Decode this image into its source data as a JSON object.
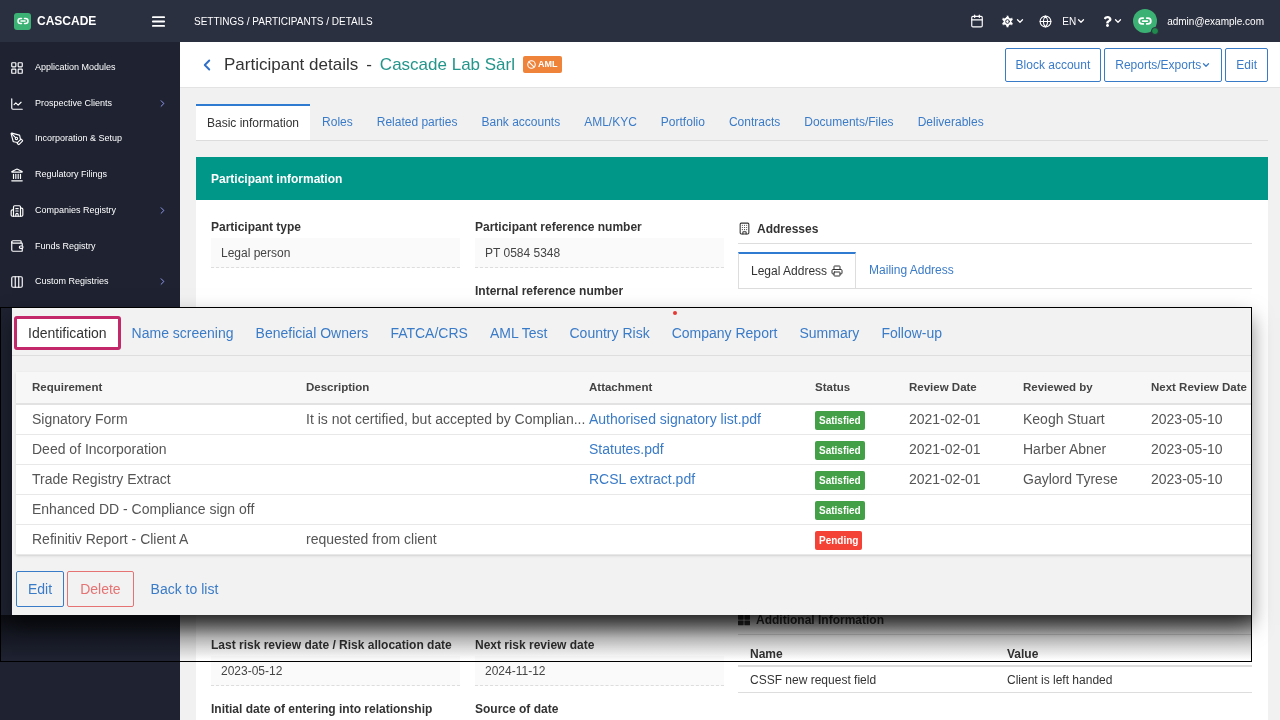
{
  "top_bar": {
    "brand": "CASCADE",
    "breadcrumb": "SETTINGS / PARTICIPANTS / DETAILS",
    "language": "EN",
    "user": "admin@example.com",
    "user_online": true
  },
  "sidebar": {
    "items": [
      {
        "label": "Application Modules",
        "submenu": false
      },
      {
        "label": "Prospective Clients",
        "submenu": true
      },
      {
        "label": "Incorporation & Setup",
        "submenu": false
      },
      {
        "label": "Regulatory Filings",
        "submenu": false
      },
      {
        "label": "Companies Registry",
        "submenu": true
      },
      {
        "label": "Funds Registry",
        "submenu": false
      },
      {
        "label": "Custom Registries",
        "submenu": true
      }
    ]
  },
  "header": {
    "title": "Participant details",
    "separator": "-",
    "participant": "Cascade Lab Sàrl",
    "badge": "AML",
    "buttons": [
      {
        "label": "Block account",
        "dropdown": false
      },
      {
        "label": "Reports/Exports",
        "dropdown": true
      },
      {
        "label": "Edit",
        "dropdown": false
      }
    ]
  },
  "tabs": [
    {
      "label": "Basic information",
      "selected": true
    },
    {
      "label": "Roles",
      "selected": false
    },
    {
      "label": "Related parties",
      "selected": false
    },
    {
      "label": "Bank accounts",
      "selected": false
    },
    {
      "label": "AML/KYC",
      "selected": false
    },
    {
      "label": "Portfolio",
      "selected": false
    },
    {
      "label": "Contracts",
      "selected": false
    },
    {
      "label": "Documents/Files",
      "selected": false
    },
    {
      "label": "Deliverables",
      "selected": false
    }
  ],
  "participant_info": {
    "title": "Participant information",
    "left_fields": [
      {
        "label": "Participant type",
        "value": "Legal person"
      }
    ],
    "middle_fields": [
      {
        "label": "Participant reference number",
        "value": "PT 0584 5348"
      },
      {
        "label": "Internal reference number"
      }
    ],
    "lower_fields": [
      [
        {
          "label": "Last risk review date / Risk allocation date",
          "value": "2023-05-12"
        },
        {
          "label": "Next risk review date",
          "value": "2024-11-12"
        }
      ],
      [
        {
          "label": "Initial date of entering into relationship"
        },
        {
          "label": "Source of date"
        }
      ]
    ]
  },
  "addresses": {
    "title": "Addresses",
    "tabs": [
      {
        "label": "Legal Address",
        "selected": true,
        "printable": true
      },
      {
        "label": "Mailing Address",
        "selected": false,
        "printable": false
      }
    ]
  },
  "additional_information": {
    "title": "Additional Information",
    "columns": [
      "Name",
      "Value"
    ],
    "rows": [
      [
        "CSSF new request field",
        "Client is left handed"
      ]
    ]
  },
  "aml_panel": {
    "tabs": [
      {
        "label": "Identification",
        "selected": true,
        "alert": false
      },
      {
        "label": "Name screening",
        "selected": false,
        "alert": false
      },
      {
        "label": "Beneficial Owners",
        "selected": false,
        "alert": false
      },
      {
        "label": "FATCA/CRS",
        "selected": false,
        "alert": false
      },
      {
        "label": "AML Test",
        "selected": false,
        "alert": false
      },
      {
        "label": "Country Risk",
        "selected": false,
        "alert": false
      },
      {
        "label": "Company Report",
        "selected": false,
        "alert": true
      },
      {
        "label": "Summary",
        "selected": false,
        "alert": false
      },
      {
        "label": "Follow-up",
        "selected": false,
        "alert": false
      }
    ],
    "table": {
      "columns": [
        "Requirement",
        "Description",
        "Attachment",
        "Status",
        "Review Date",
        "Reviewed by",
        "Next Review Date"
      ],
      "rows": [
        {
          "requirement": "Signatory Form",
          "description": "It is not certified, but accepted by Complian...",
          "attachment": "Authorised signatory list.pdf",
          "status": {
            "label": "Satisfied",
            "color": "#43a047"
          },
          "review_date": "2021-02-01",
          "reviewed_by": "Keogh Stuart",
          "next_review_date": "2023-05-10"
        },
        {
          "requirement": "Deed of Incorporation",
          "attachment": "Statutes.pdf",
          "status": {
            "label": "Satisfied",
            "color": "#43a047"
          },
          "review_date": "2021-02-01",
          "reviewed_by": "Harber Abner",
          "next_review_date": "2023-05-10"
        },
        {
          "requirement": "Trade Registry Extract",
          "attachment": "RCSL extract.pdf",
          "status": {
            "label": "Satisfied",
            "color": "#43a047"
          },
          "review_date": "2021-02-01",
          "reviewed_by": "Gaylord Tyrese",
          "next_review_date": "2023-05-10"
        },
        {
          "requirement": "Enhanced DD - Compliance sign off",
          "status": {
            "label": "Satisfied",
            "color": "#43a047"
          }
        },
        {
          "requirement": "Refinitiv Report - Client A",
          "description": "requested from client",
          "status": {
            "label": "Pending",
            "color": "#f44336"
          }
        }
      ]
    },
    "actions": {
      "edit": "Edit",
      "delete": "Delete",
      "back": "Back to list"
    }
  }
}
